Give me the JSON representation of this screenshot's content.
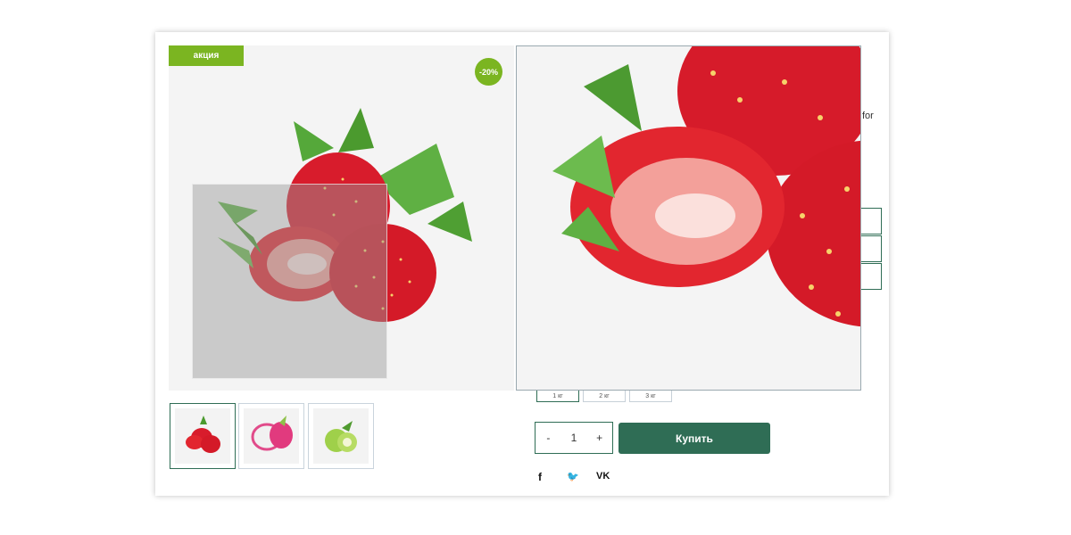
{
  "product": {
    "promo_label": "акция",
    "discount_label": "-20%",
    "main_image": "strawberries",
    "thumbnails": [
      {
        "name": "strawberries",
        "active": true
      },
      {
        "name": "dragon-fruit",
        "active": false
      },
      {
        "name": "green-apple",
        "active": false
      }
    ],
    "description_fragment": "for",
    "weights": [
      {
        "label": "1 кг",
        "active": true
      },
      {
        "label": "2 кг",
        "active": false
      },
      {
        "label": "3 кг",
        "active": false
      }
    ],
    "quantity": {
      "minus": "-",
      "value": "1",
      "plus": "+"
    },
    "buy_label": "Купить",
    "social": {
      "facebook": "f",
      "twitter": "🐦",
      "vk": "VK"
    }
  },
  "colors": {
    "accent_green": "#7bb521",
    "primary": "#2f6d55"
  }
}
